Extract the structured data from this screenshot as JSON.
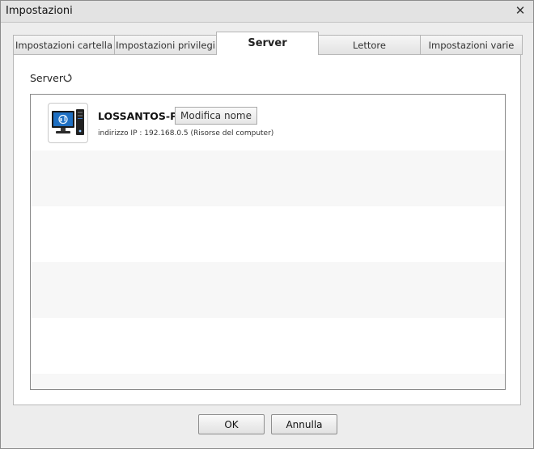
{
  "window": {
    "title": "Impostazioni"
  },
  "tabs": [
    {
      "label": "Impostazioni cartella",
      "active": false
    },
    {
      "label": "Impostazioni privilegi",
      "active": false
    },
    {
      "label": "Server",
      "active": true
    },
    {
      "label": "Lettore",
      "active": false
    },
    {
      "label": "Impostazioni varie",
      "active": false
    }
  ],
  "section": {
    "label": "Server",
    "icon": "refresh-icon"
  },
  "servers": [
    {
      "name": "LOSSANTOS-PC",
      "rename_label": "Modifica nome",
      "ip_text": "indirizzo IP : 192.168.0.5 (Risorse del computer)",
      "icon": "desktop-computer-icon"
    }
  ],
  "footer": {
    "ok_label": "OK",
    "cancel_label": "Annulla"
  },
  "colors": {
    "window_bg": "#ededed",
    "row_alt": "#f7f7f7",
    "monitor_blue": "#1e6fc2"
  }
}
